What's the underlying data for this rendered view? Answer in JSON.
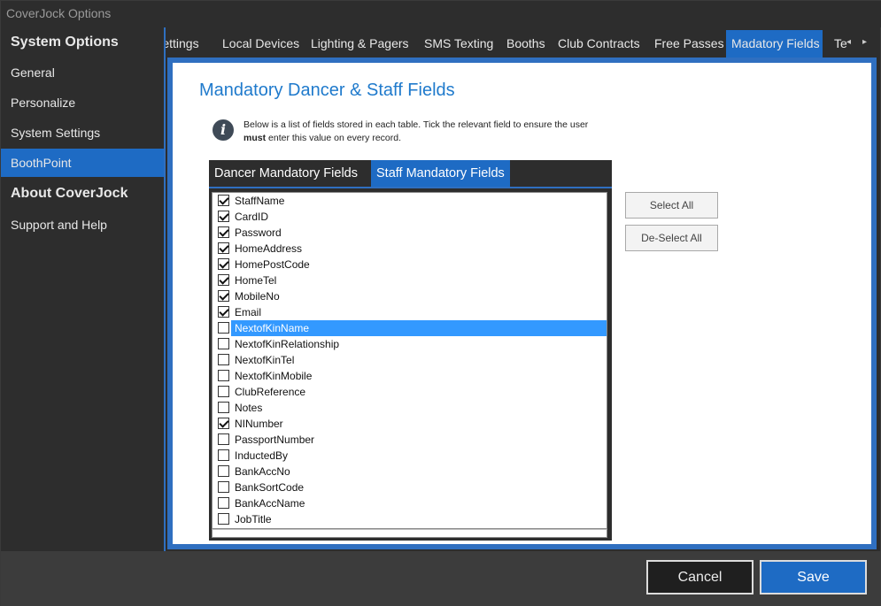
{
  "window": {
    "title": "CoverJock Options"
  },
  "sidebar": {
    "items": [
      {
        "label": "System Options",
        "header": true
      },
      {
        "label": "General"
      },
      {
        "label": "Personalize"
      },
      {
        "label": "System Settings"
      },
      {
        "label": "BoothPoint",
        "active": true
      },
      {
        "label": "About CoverJock",
        "header": true
      },
      {
        "label": "Support and Help"
      }
    ]
  },
  "tabs": {
    "items": [
      {
        "label": "Settings"
      },
      {
        "label": "Local Devices"
      },
      {
        "label": "Lighting & Pagers"
      },
      {
        "label": "SMS Texting"
      },
      {
        "label": "Booths"
      },
      {
        "label": "Club Contracts"
      },
      {
        "label": "Free Passes"
      },
      {
        "label": "Madatory Fields",
        "active": true
      },
      {
        "label": "Te"
      }
    ],
    "scroll_left": "◂",
    "scroll_right": "▸"
  },
  "main": {
    "title": "Mandatory Dancer & Staff Fields",
    "info_prefix": "Below is a list of fields stored in each table. Tick the relevant field to ensure the user ",
    "info_bold": "must",
    "info_suffix": " enter this value on every record.",
    "subtabs": [
      {
        "label": "Dancer Mandatory Fields"
      },
      {
        "label": "Staff Mandatory Fields",
        "active": true
      }
    ],
    "fields": [
      {
        "label": "StaffName",
        "checked": true
      },
      {
        "label": "CardID",
        "checked": true
      },
      {
        "label": "Password",
        "checked": true
      },
      {
        "label": "HomeAddress",
        "checked": true
      },
      {
        "label": "HomePostCode",
        "checked": true
      },
      {
        "label": "HomeTel",
        "checked": true
      },
      {
        "label": "MobileNo",
        "checked": true
      },
      {
        "label": "Email",
        "checked": true
      },
      {
        "label": "NextofKinName",
        "checked": false,
        "selected": true
      },
      {
        "label": "NextofKinRelationship",
        "checked": false
      },
      {
        "label": "NextofKinTel",
        "checked": false
      },
      {
        "label": "NextofKinMobile",
        "checked": false
      },
      {
        "label": "ClubReference",
        "checked": false
      },
      {
        "label": "Notes",
        "checked": false
      },
      {
        "label": "NINumber",
        "checked": true
      },
      {
        "label": "PassportNumber",
        "checked": false
      },
      {
        "label": "InductedBy",
        "checked": false
      },
      {
        "label": "BankAccNo",
        "checked": false
      },
      {
        "label": "BankSortCode",
        "checked": false
      },
      {
        "label": "BankAccName",
        "checked": false
      },
      {
        "label": "JobTitle",
        "checked": false
      }
    ],
    "select_all_label": "Select All",
    "deselect_all_label": "De-Select All"
  },
  "footer": {
    "cancel_label": "Cancel",
    "save_label": "Save"
  },
  "colors": {
    "accent": "#1e6bc4",
    "title_blue": "#1f7acc",
    "selection": "#3399ff",
    "background_dark": "#2d2d2d"
  }
}
